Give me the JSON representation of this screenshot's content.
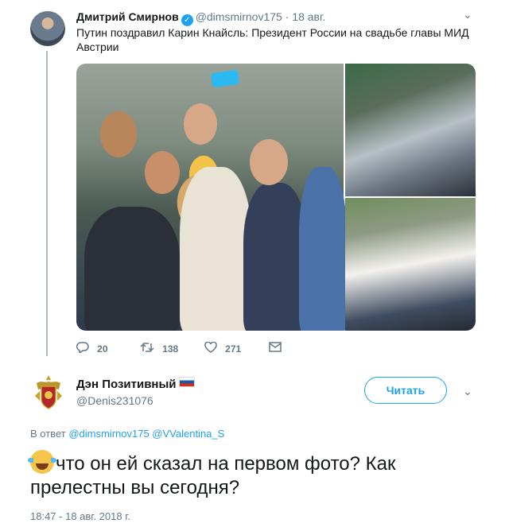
{
  "tweet1": {
    "author_name": "Дмитрий Смирнов",
    "verified_symbol": "✓",
    "handle": "@dimsmirnov175",
    "separator": "·",
    "date": "18 авг.",
    "text": "Путин поздравил Карин Кнайсль: Президент России на свадьбе главы МИД Австрии",
    "caret": "⌄",
    "actions": {
      "reply_icon": "reply-icon",
      "reply_count": "20",
      "retweet_icon": "retweet-icon",
      "retweet_count": "138",
      "like_icon": "heart-icon",
      "like_count": "271",
      "dm_icon": "envelope-icon"
    }
  },
  "tweet2": {
    "author_name": "Дэн Позитивный",
    "handle": "@Denis231076",
    "follow_label": "Читать",
    "caret": "⌄",
    "reply_prefix": "В ответ",
    "reply_to_1": "@dimsmirnov175",
    "reply_to_2": "@VValentina_S",
    "text": "что он ей сказал на первом фото? Как прелестны вы сегодня?",
    "timestamp": "18:47 - 18 авг. 2018 г."
  },
  "colors": {
    "accent": "#1da1f2",
    "text": "#14171a",
    "secondary": "#657786",
    "thread_line": "#aab8c2"
  }
}
